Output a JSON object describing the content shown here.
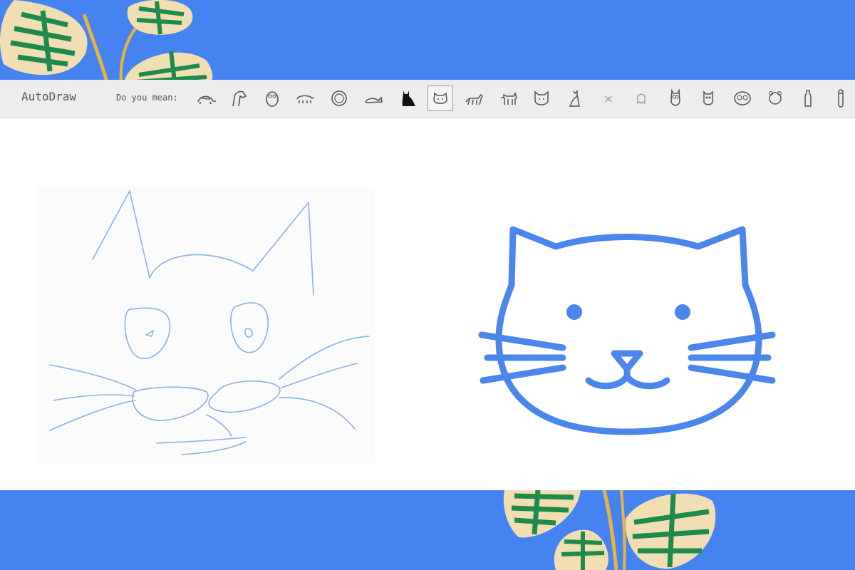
{
  "app": {
    "title": "AutoDraw"
  },
  "toolbar": {
    "suggest_label": "Do you mean:",
    "selected_index": 8,
    "suggestions": [
      {
        "icon": "turtle-icon"
      },
      {
        "icon": "horse-head-icon"
      },
      {
        "icon": "owl-icon"
      },
      {
        "icon": "pig-icon"
      },
      {
        "icon": "lion-face-icon"
      },
      {
        "icon": "lying-cat-icon"
      },
      {
        "icon": "black-cat-icon"
      },
      {
        "icon": "cat-face-icon"
      },
      {
        "icon": "walking-cat-icon"
      },
      {
        "icon": "dog-icon"
      },
      {
        "icon": "cat-head-icon"
      },
      {
        "icon": "sitting-cat-icon"
      },
      {
        "icon": "bug-icon"
      },
      {
        "icon": "ghost-icon"
      },
      {
        "icon": "owl-tall-icon"
      },
      {
        "icon": "owl-small-icon"
      },
      {
        "icon": "owl-face-icon"
      },
      {
        "icon": "bear-icon"
      },
      {
        "icon": "bottle-icon"
      },
      {
        "icon": "tube-icon"
      }
    ]
  },
  "colors": {
    "background": "#4584f0",
    "sketch_stroke": "#8ab0ee",
    "result_stroke": "#4a86ec",
    "leaf_fill": "#f1dfb3",
    "leaf_stripe": "#1e8a4c",
    "stem": "#e7b53c"
  }
}
